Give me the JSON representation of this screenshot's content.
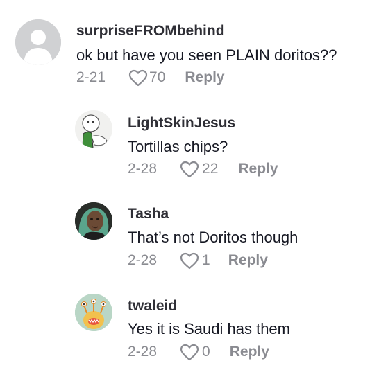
{
  "comments": [
    {
      "username": "surpriseFROMbehind",
      "text": "ok but have you seen PLAIN doritos??",
      "date": "2-21",
      "likes": "70",
      "reply": "Reply",
      "avatar_icon": "default-avatar-icon"
    },
    {
      "username": "LightSkinJesus",
      "text": "Tortillas chips?",
      "date": "2-28",
      "likes": "22",
      "reply": "Reply",
      "avatar_icon": "doodle-avatar-icon"
    },
    {
      "username": "Tasha",
      "text": "That’s not Doritos though",
      "date": "2-28",
      "likes": "1",
      "reply": "Reply",
      "avatar_icon": "photo-avatar-icon"
    },
    {
      "username": "twaleid",
      "text": "Yes it is Saudi has them",
      "date": "2-28",
      "likes": "0",
      "reply": "Reply",
      "avatar_icon": "monster-avatar-icon"
    }
  ],
  "colors": {
    "username": "#2f2f36",
    "text": "#161823",
    "meta": "#8a8b91",
    "default_avatar_bg": "#d0d1d3",
    "monster_avatar_bg": "#b9d6c6"
  }
}
